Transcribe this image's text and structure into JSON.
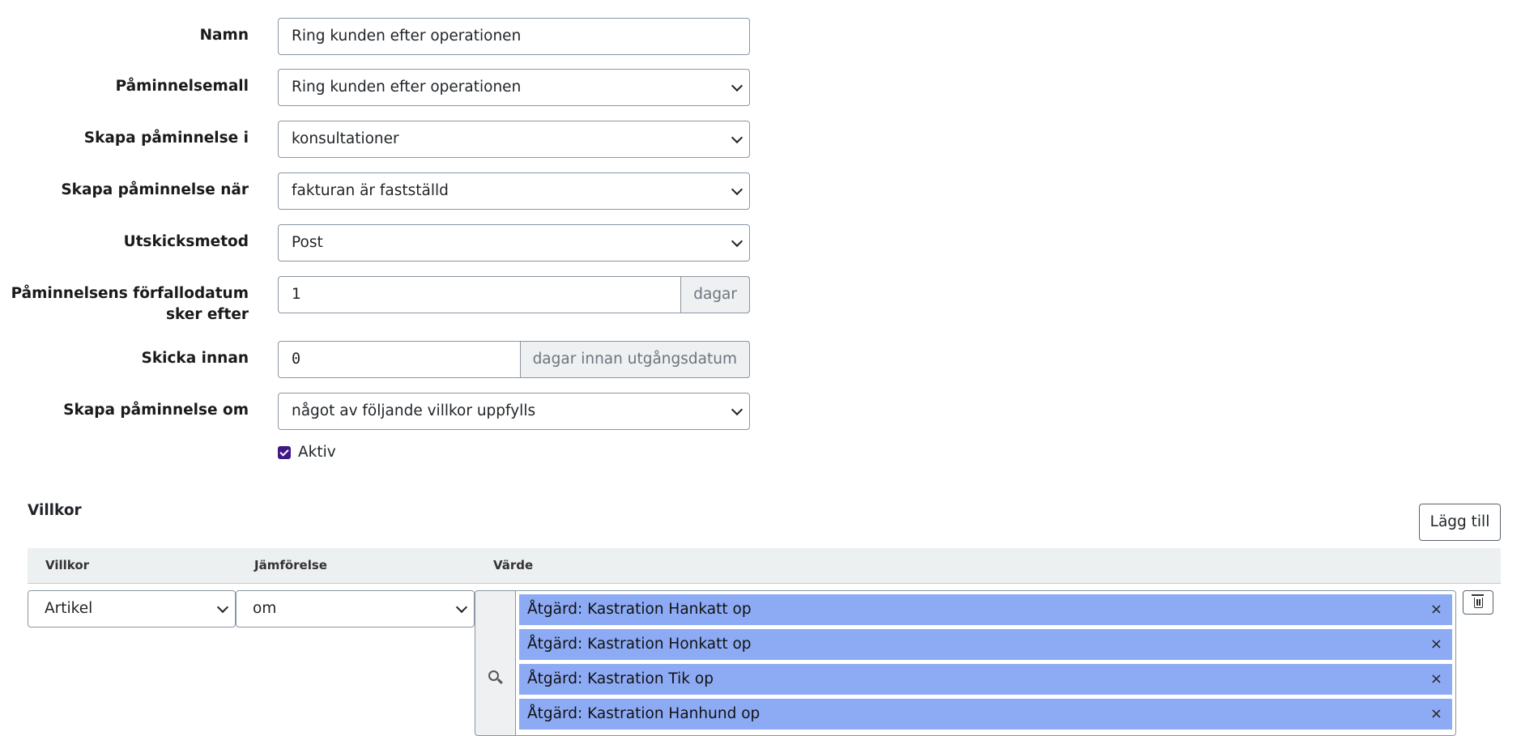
{
  "form": {
    "name_label": "Namn",
    "name_value": "Ring kunden efter operationen",
    "template_label": "Påminnelsemall",
    "template_value": "Ring kunden efter operationen",
    "create_in_label": "Skapa påminnelse i",
    "create_in_value": "konsultationer",
    "create_when_label": "Skapa påminnelse när",
    "create_when_value": "fakturan är fastställd",
    "send_method_label": "Utskicksmetod",
    "send_method_value": "Post",
    "due_label_line1": "Påminnelsens förfallodatum",
    "due_label_line2": "sker efter",
    "due_value": "1",
    "due_unit": "dagar",
    "send_before_label": "Skicka innan",
    "send_before_value": "0",
    "send_before_unit": "dagar innan utgångsdatum",
    "create_if_label": "Skapa påminnelse om",
    "create_if_value": "något av följande villkor uppfylls",
    "active_label": "Aktiv",
    "active_checked": true
  },
  "conditions": {
    "title": "Villkor",
    "add_button": "Lägg till",
    "columns": [
      "Villkor",
      "Jämförelse",
      "Värde"
    ],
    "rows": [
      {
        "condition": "Artikel",
        "comparison": "om",
        "values": [
          "Åtgärd: Kastration Hankatt op",
          "Åtgärd: Kastration Honkatt op",
          "Åtgärd: Kastration Tik op",
          "Åtgärd: Kastration Hanhund op"
        ],
        "remove_glyph": "×"
      }
    ]
  },
  "icons": {
    "search": "search-icon",
    "delete": "trash-icon",
    "dropdown": "chevron-down-icon",
    "checkbox": "checkbox-checked"
  },
  "colors": {
    "tag_bg": "#8dabf5",
    "checkbox": "#3f1787",
    "table_header_bg": "#edf0f1"
  }
}
